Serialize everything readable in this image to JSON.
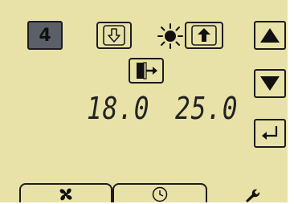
{
  "display": {
    "mode_number": "4",
    "setpoint_low": "18.0",
    "setpoint_high": "25.0"
  },
  "icons": {
    "mode_down": "down-arrow-in-box-icon",
    "mode_up": "up-arrow-in-box-icon",
    "sun": "sun-icon",
    "exit": "door-exit-icon",
    "nav_up": "triangle-up-icon",
    "nav_down": "triangle-down-icon",
    "enter": "enter-return-icon",
    "fan": "fan-icon",
    "clock": "clock-icon",
    "wrench": "wrench-icon"
  },
  "colors": {
    "lcd_background": "#e8e2a8",
    "ink": "#1c1c1c",
    "badge_fill": "#5b5f68"
  }
}
